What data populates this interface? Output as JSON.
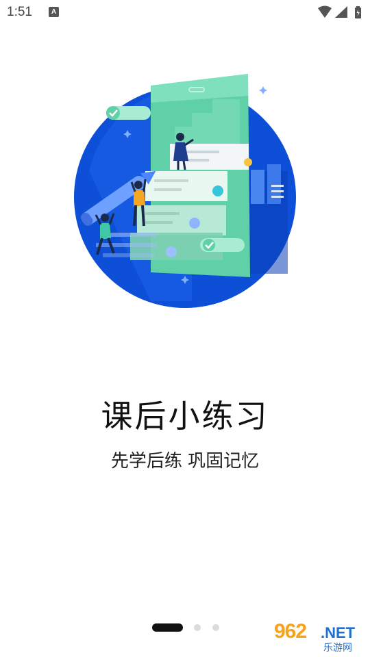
{
  "status_bar": {
    "time": "1:51",
    "notification_icon": "A"
  },
  "onboarding": {
    "title": "课后小练习",
    "subtitle": "先学后练 巩固记忆",
    "page_count": 3,
    "current_page": 1
  },
  "watermark": {
    "brand": "962",
    "domain": ".NET",
    "name": "乐游网"
  },
  "colors": {
    "circle_blue": "#0d4fd6",
    "accent_green": "#5fd0a8",
    "pager_active": "#111111",
    "pager_inactive": "#dcdcdc"
  }
}
